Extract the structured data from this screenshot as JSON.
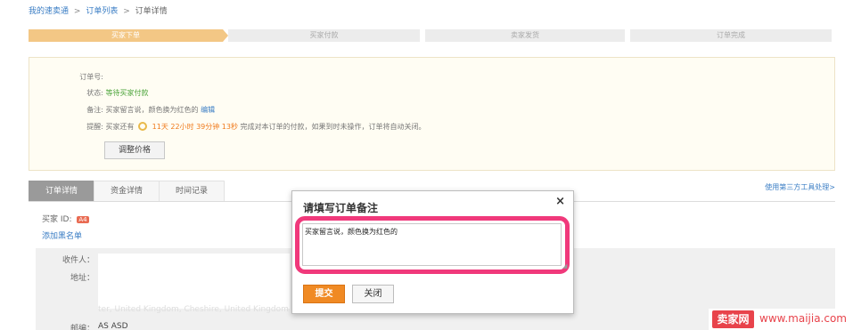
{
  "breadcrumb": {
    "home": "我的速卖通",
    "list": "订单列表",
    "current": "订单详情",
    "sep": ">"
  },
  "steps": [
    "买家下单",
    "买家付款",
    "卖家发货",
    "订单完成"
  ],
  "order": {
    "order_no_label": "订单号:",
    "order_no_value": "",
    "status_label": "状态:",
    "status_value": "等待买家付款",
    "note_label": "备注:",
    "note_value": "买家留言说，颜色换为红色的",
    "note_edit": "编辑",
    "remind_label": "提醒:",
    "remind_prefix": "买家还有",
    "countdown": "11天 22小时 39分钟 13秒",
    "remind_suffix": "完成对本订单的付款，如果到时未操作，订单将自动关闭。",
    "adjust_price": "调整价格"
  },
  "tabs": [
    "订单详情",
    "资金详情",
    "时间记录"
  ],
  "third_party_link": "使用第三方工具处理>",
  "buyer": {
    "label": "买家 ID:",
    "badge": "A4",
    "blacklist": "添加黑名单"
  },
  "address": {
    "recipient_label": "收件人：",
    "address_label": "地址：",
    "address_line": "ter, United Kingdom, Cheshire, United Kingdom",
    "postal_label": "邮编：",
    "postal_value": "AS ASD"
  },
  "modal": {
    "title": "请填写订单备注",
    "close_symbol": "×",
    "textarea_value": "买家留言说，颜色换为红色的",
    "submit": "提交",
    "close": "关闭",
    "highlight_color": "#f0397b"
  },
  "watermark": {
    "logo": "卖家网",
    "url": "www.maijia.com"
  },
  "colors": {
    "link": "#3a7dc4",
    "status_green": "#4aa338",
    "countdown_orange": "#f07c1e",
    "step_active": "#f3c785",
    "submit_orange": "#f08a24"
  }
}
